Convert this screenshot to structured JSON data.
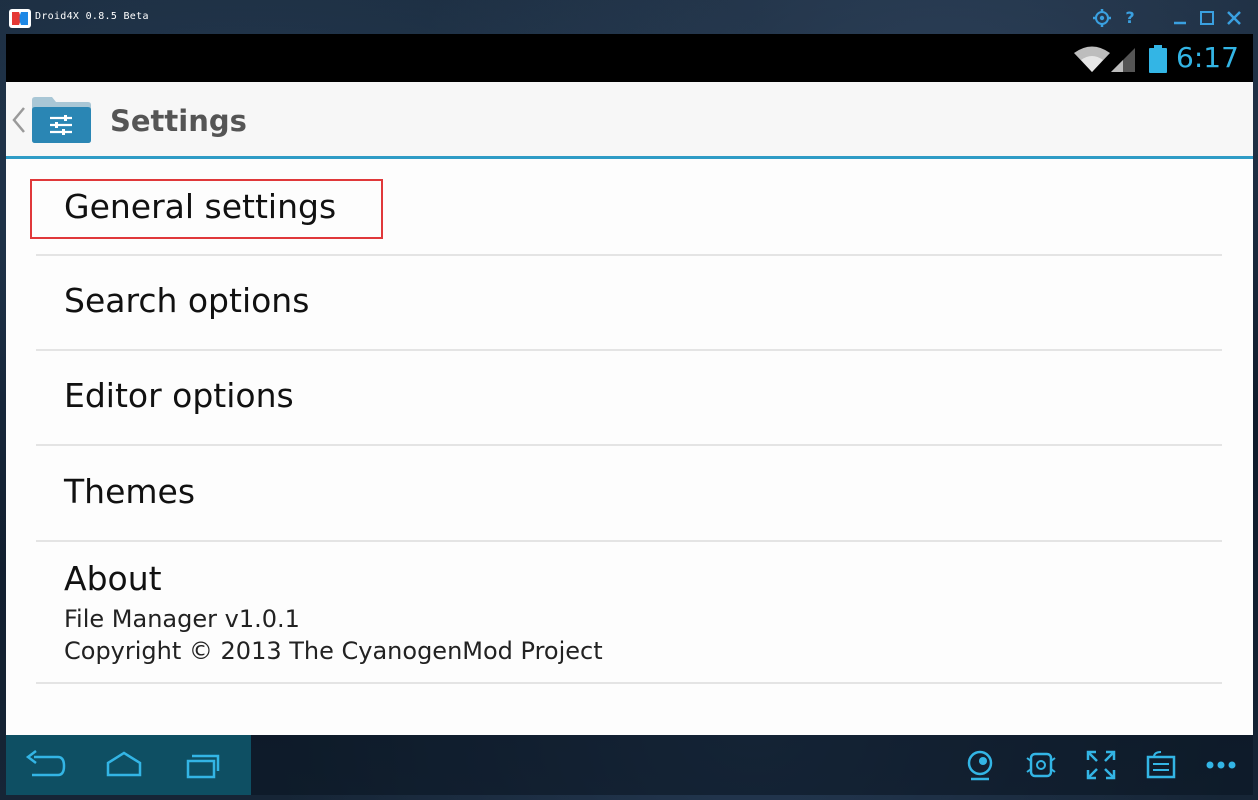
{
  "emulator": {
    "title": "Droid4X 0.8.5 Beta",
    "title_buttons": [
      "gear-icon",
      "help-icon",
      "minimize-icon",
      "maximize-icon",
      "close-icon"
    ],
    "help_label": "?",
    "accent_color": "#3aa0e0"
  },
  "status_bar": {
    "time": "6:17",
    "icons": [
      "wifi-icon",
      "signal-icon",
      "battery-icon"
    ],
    "accent_color": "#33b5e5"
  },
  "action_bar": {
    "title": "Settings",
    "icon": "settings-folder-icon",
    "underline_color": "#2f9cc6"
  },
  "settings_list": [
    {
      "title": "General settings"
    },
    {
      "title": "Search options"
    },
    {
      "title": "Editor options"
    },
    {
      "title": "Themes"
    },
    {
      "title": "About",
      "lines": [
        "File Manager v1.0.1",
        "Copyright © 2013 The CyanogenMod Project"
      ]
    }
  ],
  "highlight": {
    "target": "General settings",
    "color": "#e0383a"
  },
  "nav_bar": {
    "left_buttons": [
      "back-icon",
      "home-icon",
      "recent-apps-icon"
    ],
    "right_buttons": [
      "camera-icon",
      "shake-icon",
      "fullscreen-icon",
      "keyboard-icon",
      "more-icon"
    ]
  }
}
